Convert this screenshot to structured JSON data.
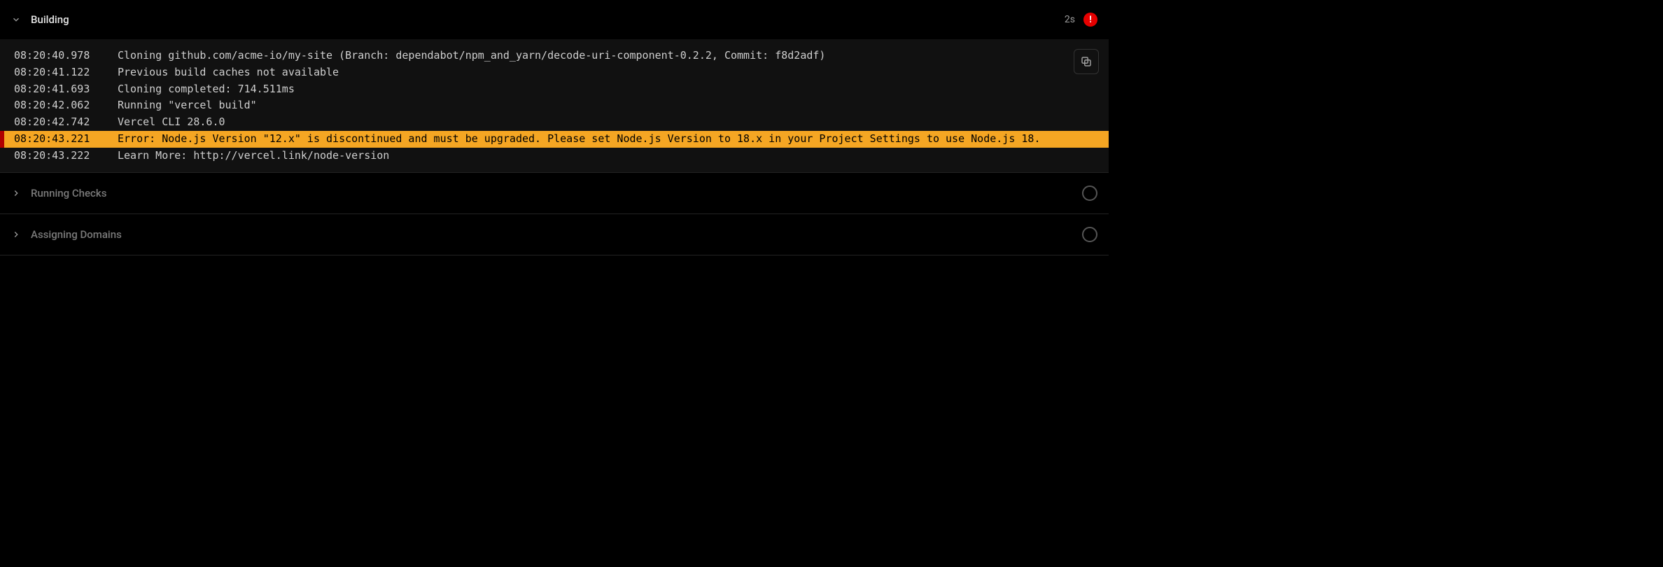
{
  "sections": {
    "building": {
      "title": "Building",
      "duration": "2s",
      "status": "error",
      "expanded": true
    },
    "checks": {
      "title": "Running Checks",
      "status": "pending",
      "expanded": false
    },
    "domains": {
      "title": "Assigning Domains",
      "status": "pending",
      "expanded": false
    }
  },
  "logs": [
    {
      "ts": "08:20:40.978",
      "msg": "Cloning github.com/acme-io/my-site (Branch: dependabot/npm_and_yarn/decode-uri-component-0.2.2, Commit: f8d2adf)",
      "level": "info"
    },
    {
      "ts": "08:20:41.122",
      "msg": "Previous build caches not available",
      "level": "info"
    },
    {
      "ts": "08:20:41.693",
      "msg": "Cloning completed: 714.511ms",
      "level": "info"
    },
    {
      "ts": "08:20:42.062",
      "msg": "Running \"vercel build\"",
      "level": "info"
    },
    {
      "ts": "08:20:42.742",
      "msg": "Vercel CLI 28.6.0",
      "level": "info"
    },
    {
      "ts": "08:20:43.221",
      "msg": "Error: Node.js Version \"12.x\" is discontinued and must be upgraded. Please set Node.js Version to 18.x in your Project Settings to use Node.js 18.",
      "level": "error"
    },
    {
      "ts": "08:20:43.222",
      "msg": "Learn More: http://vercel.link/node-version",
      "level": "info"
    }
  ],
  "icons": {
    "error_badge": "!",
    "copy": "copy"
  }
}
